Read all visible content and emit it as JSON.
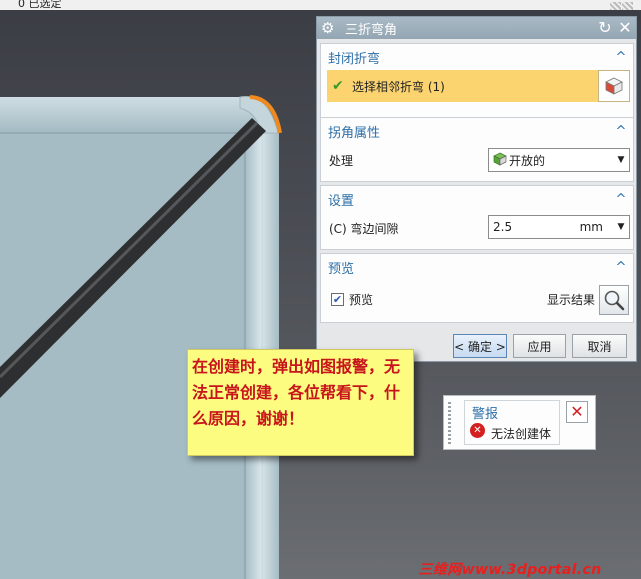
{
  "topbar": {
    "text": "0 已选定"
  },
  "dialog": {
    "title": "三折弯角",
    "sections": {
      "closed_bend": {
        "header": "封闭折弯",
        "select_label": "选择相邻折弯 (1)"
      },
      "corner_props": {
        "header": "拐角属性",
        "treatment_label": "处理",
        "treatment_value": "开放的"
      },
      "settings": {
        "header": "设置",
        "gap_label": "(C) 弯边间隙",
        "gap_value": "2.5",
        "gap_unit": "mm"
      },
      "preview": {
        "header": "预览",
        "preview_label": "预览",
        "preview_checked": true,
        "show_result_label": "显示结果"
      }
    },
    "buttons": {
      "ok": "< 确定 >",
      "apply": "应用",
      "cancel": "取消"
    }
  },
  "note": {
    "text": "在创建时，弹出如图报警，无法正常创建，各位帮看下，什么原因，谢谢！"
  },
  "warning": {
    "title": "警报",
    "message": "无法创建体"
  },
  "watermark": {
    "text": "三维网www.3dportal.cn"
  },
  "colors": {
    "accent_orange": "#f08a1e",
    "note_bg": "#fcfc80",
    "note_text": "#c8151b",
    "select_bg": "#fbd36f",
    "header_blue": "#2d6fa8"
  },
  "icons": [
    "gear-icon",
    "refresh-icon",
    "close-icon",
    "check-icon",
    "cube-select-icon",
    "dropdown-arrow-icon",
    "open-corner-icon",
    "magnifier-icon",
    "error-icon"
  ]
}
